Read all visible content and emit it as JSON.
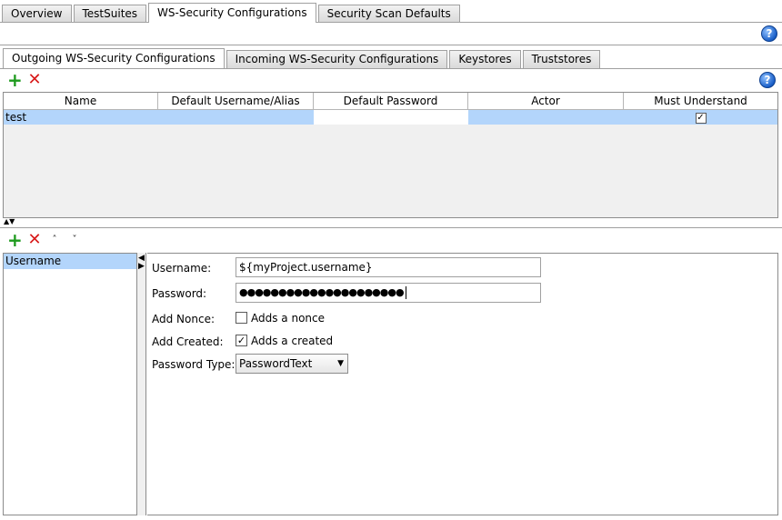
{
  "top_tabs": [
    "Overview",
    "TestSuites",
    "WS-Security Configurations",
    "Security Scan Defaults"
  ],
  "inner_tabs": [
    "Outgoing WS-Security Configurations",
    "Incoming WS-Security Configurations",
    "Keystores",
    "Truststores"
  ],
  "help": "?",
  "toolbar_icons": {
    "add": "+",
    "remove": "✕",
    "up": "˄",
    "down": "˅"
  },
  "table": {
    "columns": [
      "Name",
      "Default Username/Alias",
      "Default Password",
      "Actor",
      "Must Understand"
    ],
    "rows": [
      {
        "name": "test",
        "username": "",
        "password": "",
        "actor": "",
        "must_understand": true
      }
    ]
  },
  "splitter": {
    "up": "▲",
    "down": "▼",
    "left": "◀",
    "right": "▶"
  },
  "entries": [
    "Username"
  ],
  "form": {
    "username_label": "Username:",
    "username_value": "${myProject.username}",
    "password_label": "Password:",
    "password_value": "●●●●●●●●●●●●●●●●●●●●●",
    "nonce_label": "Add Nonce:",
    "nonce_text": "Adds a nonce",
    "nonce_checked": false,
    "created_label": "Add Created:",
    "created_text": "Adds a created",
    "created_checked": true,
    "ptype_label": "Password Type:",
    "ptype_value": "PasswordText",
    "checkmark": "✓"
  },
  "colors": {
    "selection": "#b3d5fb",
    "add": "#1e9a1e",
    "remove": "#d81a1a",
    "help": "#1a5fc8"
  }
}
